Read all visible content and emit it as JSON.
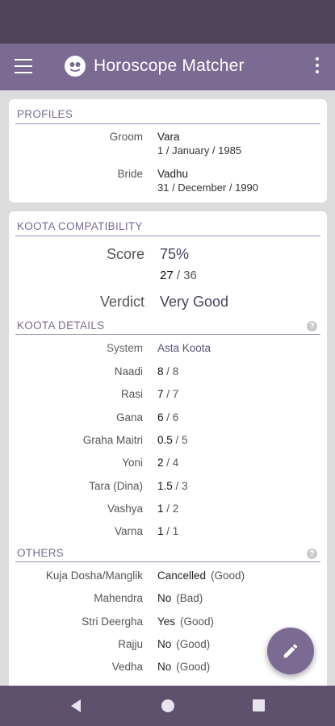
{
  "app": {
    "title": "Horoscope Matcher"
  },
  "profiles": {
    "heading": "PROFILES",
    "groom": {
      "label": "Groom",
      "name": "Vara",
      "dob": "1 / January / 1985"
    },
    "bride": {
      "label": "Bride",
      "name": "Vadhu",
      "dob": "31 / December / 1990"
    }
  },
  "compatibility": {
    "heading": "KOOTA COMPATIBILITY",
    "score_label": "Score",
    "score_percent": "75%",
    "score_value": "27",
    "score_max": "/ 36",
    "verdict_label": "Verdict",
    "verdict": "Very Good"
  },
  "details": {
    "heading": "KOOTA DETAILS",
    "system_label": "System",
    "system_value": "Asta Koota",
    "rows": [
      {
        "label": "Naadi",
        "value": "8",
        "max": "/ 8"
      },
      {
        "label": "Rasi",
        "value": "7",
        "max": "/ 7"
      },
      {
        "label": "Gana",
        "value": "6",
        "max": "/ 6"
      },
      {
        "label": "Graha Maitri",
        "value": "0.5",
        "max": "/ 5"
      },
      {
        "label": "Yoni",
        "value": "2",
        "max": "/ 4"
      },
      {
        "label": "Tara (Dina)",
        "value": "1.5",
        "max": "/ 3"
      },
      {
        "label": "Vashya",
        "value": "1",
        "max": "/ 2"
      },
      {
        "label": "Varna",
        "value": "1",
        "max": "/ 1"
      }
    ]
  },
  "others": {
    "heading": "OTHERS",
    "rows": [
      {
        "label": "Kuja Dosha/Manglik",
        "value": "Cancelled",
        "note": "(Good)"
      },
      {
        "label": "Mahendra",
        "value": "No",
        "note": "(Bad)"
      },
      {
        "label": "Stri Deergha",
        "value": "Yes",
        "note": "(Good)"
      },
      {
        "label": "Rajju",
        "value": "No",
        "note": "(Good)"
      },
      {
        "label": "Vedha",
        "value": "No",
        "note": "(Good)"
      }
    ]
  },
  "icons": {
    "menu": "hamburger-menu-icon",
    "logo": "app-logo-icon",
    "overflow": "more-vert-icon",
    "help": "help-icon",
    "fab": "edit-pencil-icon",
    "nav_back": "nav-back-icon",
    "nav_home": "nav-home-icon",
    "nav_recent": "nav-recents-icon"
  },
  "colors": {
    "primary": "#7b6a92",
    "status_bar": "#4d4459",
    "nav_bar": "#5d516e",
    "section_text": "#7a6a96"
  }
}
